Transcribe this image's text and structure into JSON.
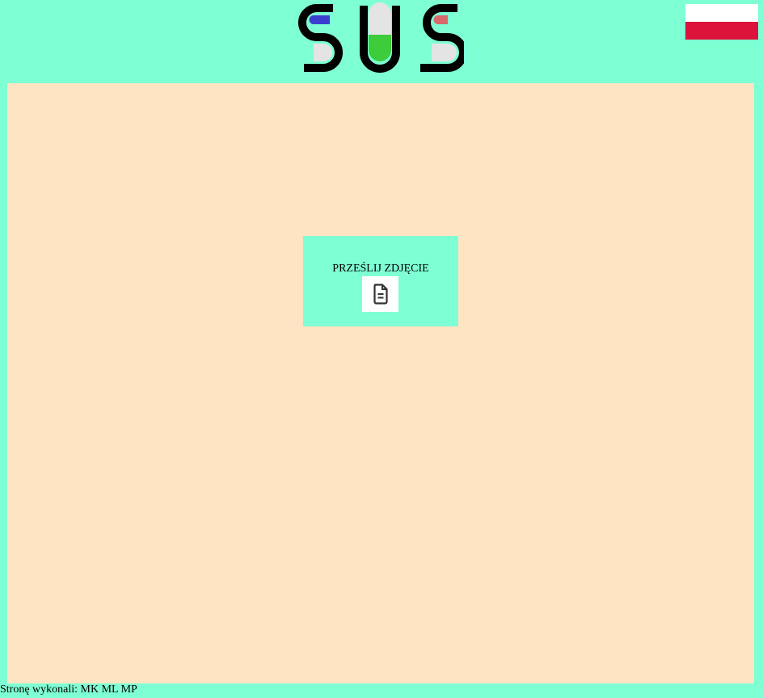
{
  "header": {
    "logo_text": "SUS",
    "language_flag": {
      "icon": "poland-flag-icon",
      "colors": [
        "#ffffff",
        "#dc143c"
      ]
    }
  },
  "main": {
    "upload": {
      "label": "PRZEŚLIJ ZDJĘCIE",
      "icon": "document-icon"
    }
  },
  "footer": {
    "credits": "Stronę wykonali: MK ML MP"
  },
  "colors": {
    "page_background": "#7fffd4",
    "content_background": "#ffe4c4",
    "logo_black": "#000000",
    "pill_blue": "#3b3fcf",
    "pill_green": "#3ccc3c",
    "pill_red": "#d9696a",
    "pill_light": "#e4e4e4"
  }
}
